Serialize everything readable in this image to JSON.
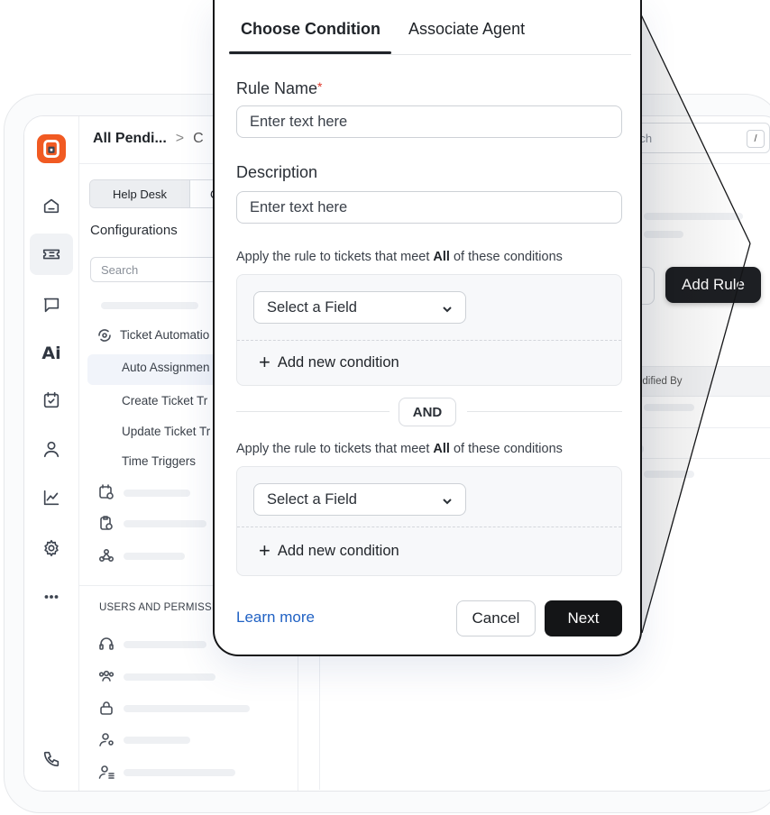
{
  "colors": {
    "brand": "#f15a22",
    "primary_button": "#141517",
    "link": "#2162c4",
    "required": "#e0382b"
  },
  "rail": {
    "icons": [
      "logo-icon",
      "home-icon",
      "ticket-icon",
      "chat-icon",
      "ai-icon",
      "task-icon",
      "user-icon",
      "chart-icon",
      "settings-icon",
      "more-icon",
      "phone-icon"
    ],
    "ai_label": "Ai"
  },
  "header": {
    "breadcrumb_first": "All Pendi...",
    "breadcrumb_sep": ">",
    "breadcrumb_next": "C"
  },
  "sidebar": {
    "segment_active": "Help Desk",
    "segment_other": "C",
    "title": "Configurations",
    "search_placeholder": "Search",
    "group_label": "Ticket Automatio",
    "items": [
      "Auto Assignmen",
      "Create Ticket Tr",
      "Update Ticket Tr",
      "Time Triggers"
    ],
    "section_label": "USERS AND PERMISSIO"
  },
  "main": {
    "search_placeholder": "rch",
    "search_shortcut": "/",
    "add_rule_label": "Add Rule",
    "table_header": "odified By"
  },
  "modal": {
    "tabs": [
      "Choose Condition",
      "Associate Agent"
    ],
    "rule_name_label": "Rule Name",
    "required_mark": "*",
    "rule_name_placeholder": "Enter text here",
    "description_label": "Description",
    "description_placeholder": "Enter text here",
    "condition_text_pre": "Apply the rule to tickets that meet ",
    "condition_text_bold": "All",
    "condition_text_post": " of these conditions",
    "select_field_label": "Select a Field",
    "add_condition_label": "Add new condition",
    "and_label": "AND",
    "learn_more": "Learn more",
    "cancel_label": "Cancel",
    "next_label": "Next"
  }
}
